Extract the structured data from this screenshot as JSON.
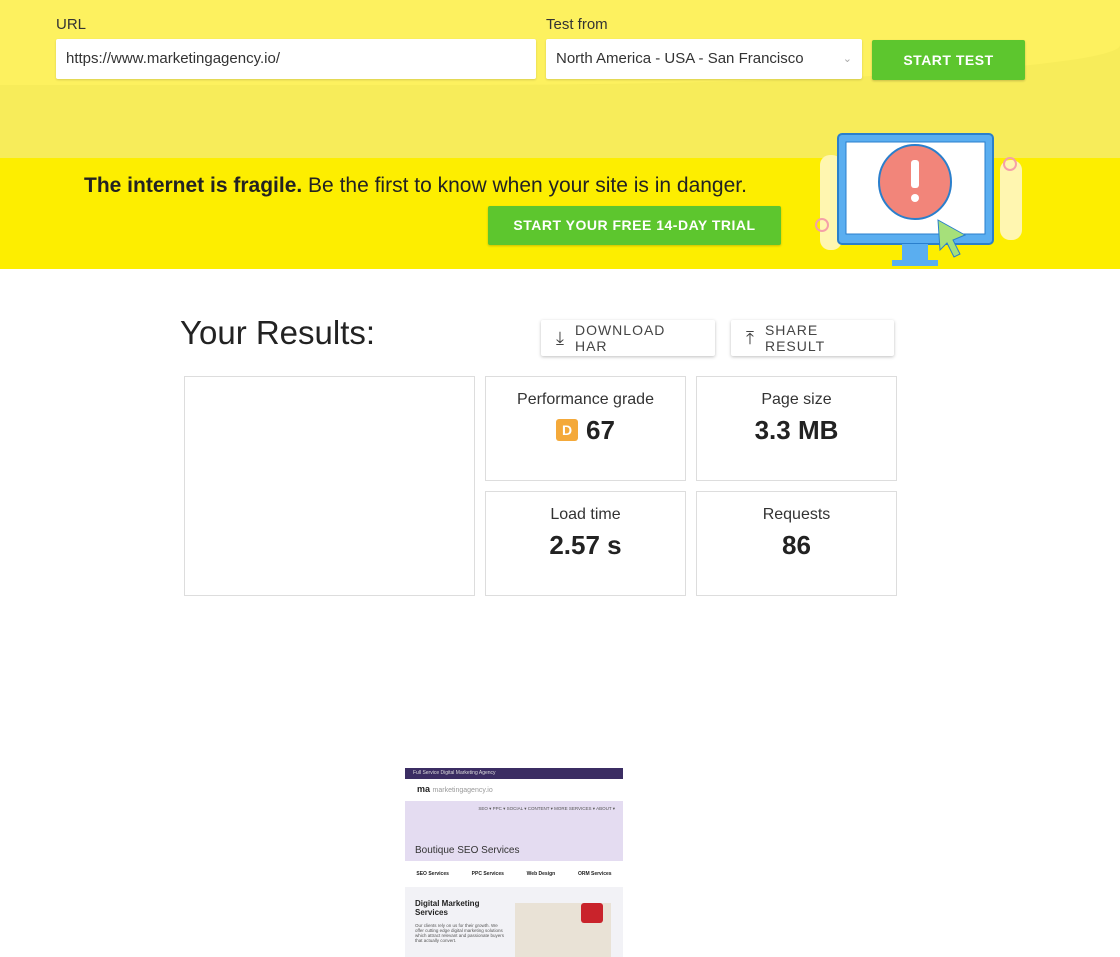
{
  "form": {
    "url_label": "URL",
    "url_value": "https://www.marketingagency.io/",
    "location_label": "Test from",
    "location_value": "North America - USA - San Francisco",
    "start_button": "START TEST"
  },
  "banner": {
    "headline_bold": "The internet is fragile.",
    "headline_rest": " Be the first to know when your site is in danger.",
    "trial_button": "START YOUR FREE 14-DAY TRIAL"
  },
  "results": {
    "title": "Your Results:",
    "download_button": "DOWNLOAD HAR",
    "share_button": "SHARE RESULT",
    "metrics": [
      {
        "label": "Performance grade",
        "grade": "D",
        "value": "67"
      },
      {
        "label": "Page size",
        "value": "3.3 MB"
      },
      {
        "label": "Load time",
        "value": "2.57 s"
      },
      {
        "label": "Requests",
        "value": "86"
      }
    ]
  },
  "thumbnail": {
    "topbar": "Full Service Digital Marketing Agency",
    "logo": "ma",
    "domain": "marketingagency.io",
    "nav": "SEO ▾  PPC ▾  SOCIAL ▾  CONTENT ▾  MORE SERVICES ▾  ABOUT ▾",
    "hero": "Boutique SEO Services",
    "services": [
      "SEO Services",
      "PPC Services",
      "Web Design",
      "ORM Services"
    ],
    "section_title": "Digital Marketing Services",
    "section_text": "Our clients rely on us for their growth. We offer cutting edge digital marketing solutions which attract relevant and passionate buyers that actually convert."
  },
  "colors": {
    "accent_green": "#5dc62e",
    "banner_yellow": "#fdee00",
    "grade_orange": "#f4a93a"
  }
}
